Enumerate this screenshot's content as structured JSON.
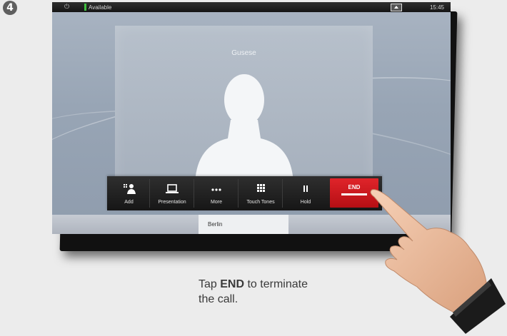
{
  "step": {
    "number": "4"
  },
  "status_bar": {
    "power_icon": "power-icon",
    "status_text": "Available",
    "status_color": "#3fbf3f",
    "time": "15:45"
  },
  "call": {
    "caller_name": "Gusese"
  },
  "toolbar": {
    "buttons": [
      {
        "label": "Add",
        "icon": "add-participant-icon"
      },
      {
        "label": "Presentation",
        "icon": "laptop-icon"
      },
      {
        "label": "More",
        "icon": "ellipsis-icon"
      },
      {
        "label": "Touch Tones",
        "icon": "keypad-icon"
      },
      {
        "label": "Hold",
        "icon": "pause-icon"
      }
    ],
    "end": {
      "label": "END",
      "color": "#d81a20"
    }
  },
  "participants": [
    {
      "name": "Berlin"
    }
  ],
  "caption": {
    "prefix": "Tap ",
    "emphasis": "END",
    "suffix": " to terminate the call."
  }
}
